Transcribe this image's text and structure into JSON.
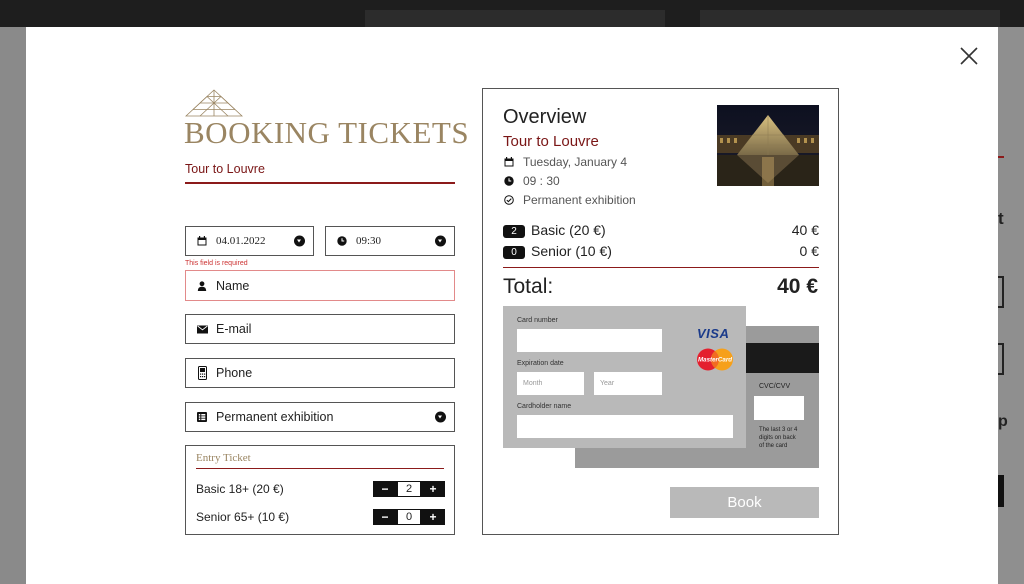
{
  "background": {},
  "modal": {
    "header": {
      "title": "BOOKING TICKETS",
      "subtitle": "Tour to Louvre"
    },
    "form": {
      "date": {
        "value": "04.01.2022"
      },
      "time": {
        "value": "09:30"
      },
      "error_text": "This field is required",
      "name": {
        "placeholder": "Name"
      },
      "email": {
        "placeholder": "E-mail"
      },
      "phone": {
        "placeholder": "Phone"
      },
      "exhibition": {
        "value": "Permanent exhibition"
      },
      "tickets": {
        "heading": "Entry Ticket",
        "rows": [
          {
            "label": "Basic 18+ (20 €)",
            "qty": "2"
          },
          {
            "label": "Senior 65+ (10 €)",
            "qty": "0"
          }
        ],
        "minus": "−",
        "plus": "+"
      }
    },
    "overview": {
      "title": "Overview",
      "tour": "Tour to Louvre",
      "date": "Tuesday, January 4",
      "time": "09 : 30",
      "exhibition": "Permanent exhibition",
      "lines": [
        {
          "qty": "2",
          "label": "Basic (20 €)",
          "amount": "40 €"
        },
        {
          "qty": "0",
          "label": "Senior (10 €)",
          "amount": "0 €"
        }
      ],
      "total_label": "Total:",
      "total_value": "40 €",
      "card": {
        "number_label": "Card number",
        "expiry_label": "Expiration date",
        "month_placeholder": "Month",
        "year_placeholder": "Year",
        "holder_label": "Cardholder name",
        "cvc_label": "CVC/CVV",
        "cvc_hint": "The last 3 or 4 digits on back of the card",
        "visa": "VISA",
        "mastercard": "MasterCard"
      },
      "book_label": "Book"
    }
  },
  "colors": {
    "accent": "#7a1616",
    "gold": "#9a8562",
    "card": "#b9b9b9"
  },
  "icons": [
    "close-icon",
    "pyramid-logo-icon",
    "calendar-icon",
    "clock-icon",
    "person-icon",
    "mail-icon",
    "phone-icon",
    "list-icon",
    "check-circle-icon",
    "chevron-down-icon"
  ]
}
